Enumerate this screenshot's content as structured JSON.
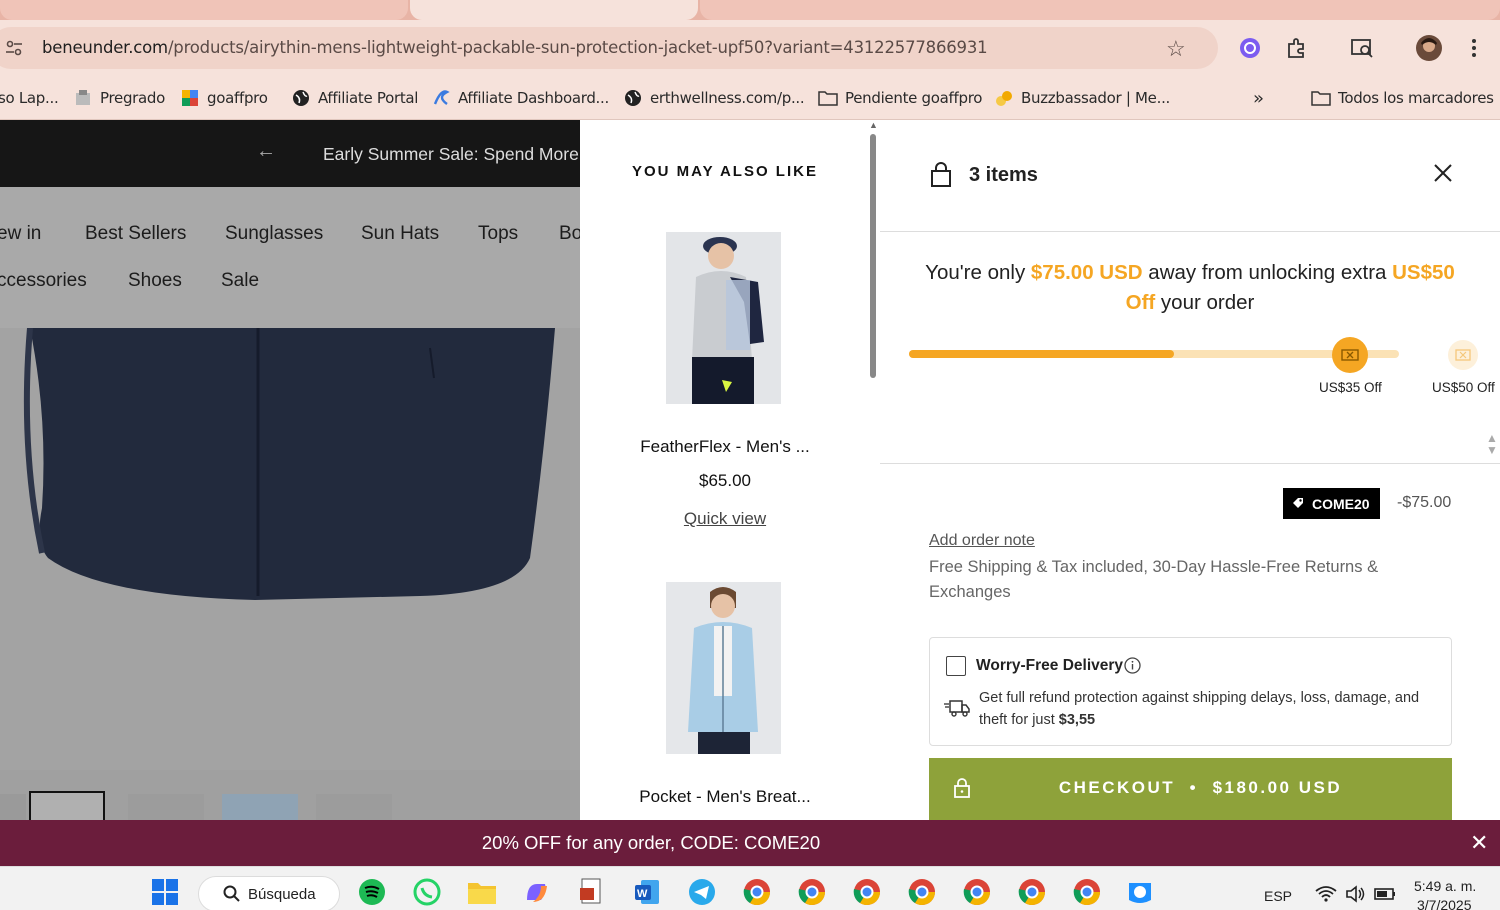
{
  "browser": {
    "url_host": "beneunder.com",
    "url_path": "/products/airythin-mens-lightweight-packable-sun-protection-jacket-upf50?variant=43122577866931",
    "bookmarks": [
      {
        "label": "so Lap..."
      },
      {
        "label": "Pregrado"
      },
      {
        "label": "goaffpro"
      },
      {
        "label": "Affiliate Portal"
      },
      {
        "label": "Affiliate Dashboard..."
      },
      {
        "label": "erthwellness.com/p..."
      },
      {
        "label": "Pendiente goaffpro"
      },
      {
        "label": "Buzzbassador | Me..."
      }
    ],
    "more_bookmarks": "»",
    "all_bookmarks": "Todos los marcadores"
  },
  "store": {
    "announcement": "Early Summer Sale: Spend More,",
    "nav_row1": [
      "ew in",
      "Best Sellers",
      "Sunglasses",
      "Sun Hats",
      "Tops",
      "Bo"
    ],
    "nav_row2": [
      "ccessories",
      "Shoes",
      "Sale"
    ]
  },
  "recommendations": {
    "title": "YOU MAY ALSO LIKE",
    "items": [
      {
        "name": "FeatherFlex - Men's ...",
        "price": "$65.00",
        "action": "Quick view"
      },
      {
        "name": "Pocket - Men's Breat..."
      }
    ]
  },
  "cart": {
    "title": "3 items",
    "promo_prefix": "You're only ",
    "promo_amount": "$75.00 USD",
    "promo_middle": " away from unlocking extra ",
    "promo_reward": "US$50 Off",
    "promo_suffix": " your order",
    "progress_fraction": 0.54,
    "milestones": [
      {
        "label": "US$35 Off",
        "reached": true
      },
      {
        "label": "US$50 Off",
        "reached": false
      }
    ],
    "discount_code": "COME20",
    "discount_amount": "-$75.00",
    "order_note_link": "Add order note",
    "shipping_note": "Free Shipping & Tax included, 30-Day Hassle-Free Returns & Exchanges",
    "worry_free": {
      "title": "Worry-Free Delivery",
      "desc_prefix": "Get full refund protection against shipping delays, loss, damage, and theft for just ",
      "price": "$3,55",
      "checked": false
    },
    "checkout_label": "CHECKOUT",
    "checkout_dot": "•",
    "checkout_total": "$180.00 USD"
  },
  "banner": {
    "text": "20% OFF for any order, CODE: COME20",
    "close": "✕"
  },
  "taskbar": {
    "search_label": "Búsqueda",
    "language": "ESP",
    "time": "5:49 a. m.",
    "date": "3/7/2025"
  },
  "colors": {
    "accent_orange": "#f5a623",
    "checkout_green": "#8ea23a",
    "banner_maroon": "#6b1d3c"
  }
}
